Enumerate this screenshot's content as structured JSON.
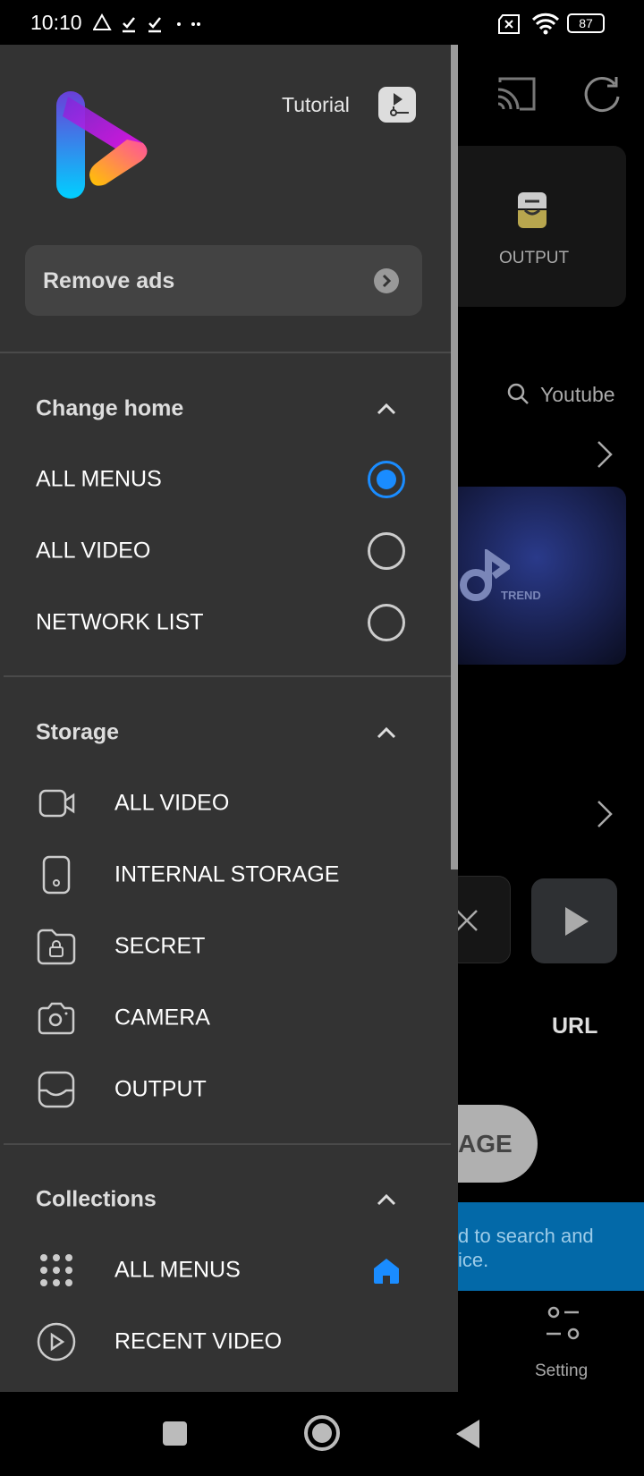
{
  "status_bar": {
    "time": "10:10",
    "battery": "87",
    "icons": [
      "drive-icon",
      "download-done-icon",
      "download-done-icon",
      "more-dots-icon",
      "no-sim-icon",
      "wifi-icon",
      "battery-icon"
    ]
  },
  "background": {
    "output_label": "OUTPUT",
    "search_placeholder": "Youtube",
    "trend_label": "TREND",
    "url_label": "URL",
    "button_partial": "AGE",
    "banner_line1": "d to search and",
    "banner_line2": "ice.",
    "setting_label": "Setting",
    "banner_color": "#0369a8"
  },
  "drawer": {
    "tutorial_label": "Tutorial",
    "remove_ads_label": "Remove ads",
    "change_home": {
      "title": "Change home",
      "options": [
        {
          "label": "ALL MENUS",
          "selected": true
        },
        {
          "label": "ALL VIDEO",
          "selected": false
        },
        {
          "label": "NETWORK LIST",
          "selected": false
        }
      ]
    },
    "storage": {
      "title": "Storage",
      "items": [
        {
          "label": "ALL VIDEO",
          "icon": "video-camera-icon"
        },
        {
          "label": "INTERNAL STORAGE",
          "icon": "phone-storage-icon"
        },
        {
          "label": "SECRET",
          "icon": "locked-folder-icon"
        },
        {
          "label": "CAMERA",
          "icon": "camera-icon"
        },
        {
          "label": "OUTPUT",
          "icon": "inbox-icon"
        }
      ]
    },
    "collections": {
      "title": "Collections",
      "items": [
        {
          "label": "ALL MENUS",
          "icon": "grid-dots-icon",
          "home": true
        },
        {
          "label": "RECENT VIDEO",
          "icon": "play-circle-icon"
        }
      ]
    },
    "accent_color": "#1a8cff"
  }
}
